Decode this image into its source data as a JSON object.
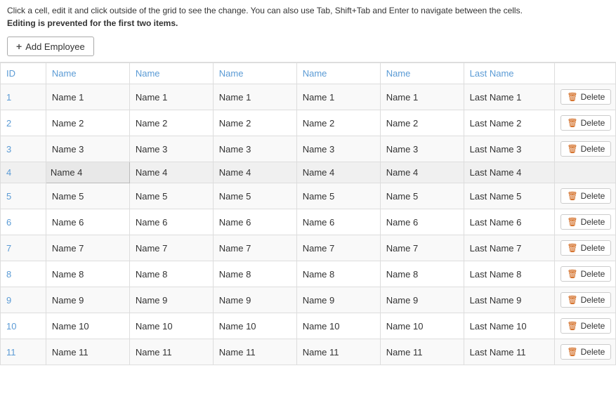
{
  "instructions": {
    "line1": "Click a cell, edit it and click outside of the grid to see the change. You can also use Tab, Shift+Tab and Enter to navigate between the cells.",
    "line2": "Editing is prevented for the first two items."
  },
  "toolbar": {
    "add_button_label": "Add Employee",
    "add_button_icon": "+"
  },
  "table": {
    "columns": [
      {
        "key": "id",
        "label": "ID"
      },
      {
        "key": "name1",
        "label": "Name"
      },
      {
        "key": "name2",
        "label": "Name"
      },
      {
        "key": "name3",
        "label": "Name"
      },
      {
        "key": "name4",
        "label": "Name"
      },
      {
        "key": "name5",
        "label": "Name"
      },
      {
        "key": "lastname",
        "label": "Last Name"
      },
      {
        "key": "action",
        "label": ""
      }
    ],
    "rows": [
      {
        "id": "1",
        "name1": "Name 1",
        "name2": "Name 1",
        "name3": "Name 1",
        "name4": "Name 1",
        "name5": "Name 1",
        "lastname": "Last Name 1",
        "has_delete": true,
        "editing": false,
        "protected": true
      },
      {
        "id": "2",
        "name1": "Name 2",
        "name2": "Name 2",
        "name3": "Name 2",
        "name4": "Name 2",
        "name5": "Name 2",
        "lastname": "Last Name 2",
        "has_delete": true,
        "editing": false,
        "protected": true
      },
      {
        "id": "3",
        "name1": "Name 3",
        "name2": "Name 3",
        "name3": "Name 3",
        "name4": "Name 3",
        "name5": "Name 3",
        "lastname": "Last Name 3",
        "has_delete": true,
        "editing": false,
        "protected": false
      },
      {
        "id": "4",
        "name1": "Name 4",
        "name2": "Name 4",
        "name3": "Name 4",
        "name4": "Name 4",
        "name5": "Name 4",
        "lastname": "Last Name 4",
        "has_delete": false,
        "editing": true,
        "protected": false
      },
      {
        "id": "5",
        "name1": "Name 5",
        "name2": "Name 5",
        "name3": "Name 5",
        "name4": "Name 5",
        "name5": "Name 5",
        "lastname": "Last Name 5",
        "has_delete": true,
        "editing": false,
        "protected": false
      },
      {
        "id": "6",
        "name1": "Name 6",
        "name2": "Name 6",
        "name3": "Name 6",
        "name4": "Name 6",
        "name5": "Name 6",
        "lastname": "Last Name 6",
        "has_delete": true,
        "editing": false,
        "protected": false
      },
      {
        "id": "7",
        "name1": "Name 7",
        "name2": "Name 7",
        "name3": "Name 7",
        "name4": "Name 7",
        "name5": "Name 7",
        "lastname": "Last Name 7",
        "has_delete": true,
        "editing": false,
        "protected": false
      },
      {
        "id": "8",
        "name1": "Name 8",
        "name2": "Name 8",
        "name3": "Name 8",
        "name4": "Name 8",
        "name5": "Name 8",
        "lastname": "Last Name 8",
        "has_delete": true,
        "editing": false,
        "protected": false
      },
      {
        "id": "9",
        "name1": "Name 9",
        "name2": "Name 9",
        "name3": "Name 9",
        "name4": "Name 9",
        "name5": "Name 9",
        "lastname": "Last Name 9",
        "has_delete": true,
        "editing": false,
        "protected": false
      },
      {
        "id": "10",
        "name1": "Name 10",
        "name2": "Name 10",
        "name3": "Name 10",
        "name4": "Name 10",
        "name5": "Name 10",
        "lastname": "Last Name 10",
        "has_delete": true,
        "editing": false,
        "protected": false
      },
      {
        "id": "11",
        "name1": "Name 11",
        "name2": "Name 11",
        "name3": "Name 11",
        "name4": "Name 11",
        "name5": "Name 11",
        "lastname": "Last Name 11",
        "has_delete": true,
        "editing": false,
        "protected": false
      }
    ],
    "delete_label": "Delete"
  }
}
